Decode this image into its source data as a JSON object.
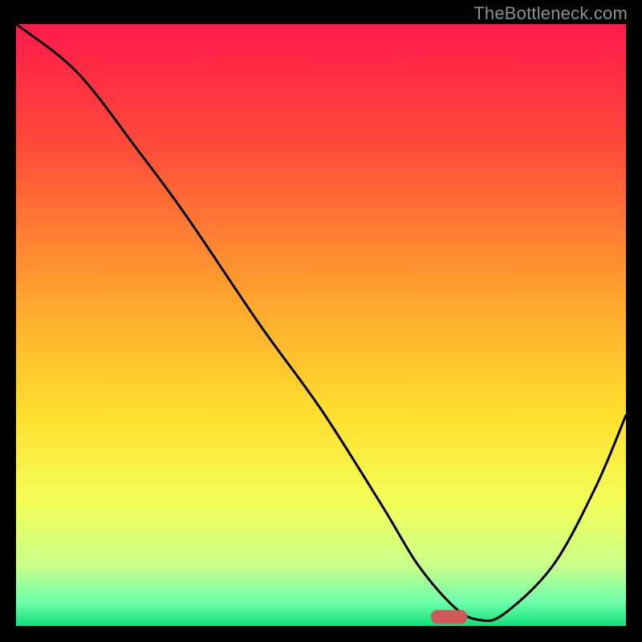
{
  "watermark": "TheBottleneck.com",
  "chart_data": {
    "type": "line",
    "title": "",
    "xlabel": "",
    "ylabel": "",
    "xlim": [
      0,
      100
    ],
    "ylim": [
      0,
      100
    ],
    "gradient_stops": [
      {
        "offset": 0,
        "color": "#ff1a4b"
      },
      {
        "offset": 20,
        "color": "#ff4a3a"
      },
      {
        "offset": 45,
        "color": "#ffa22e"
      },
      {
        "offset": 65,
        "color": "#ffe02e"
      },
      {
        "offset": 80,
        "color": "#f3ff5a"
      },
      {
        "offset": 90,
        "color": "#c9ff8a"
      },
      {
        "offset": 96,
        "color": "#6fffab"
      },
      {
        "offset": 100,
        "color": "#11e07a"
      }
    ],
    "series": [
      {
        "name": "bottleneck-curve",
        "x": [
          0,
          10,
          20,
          28,
          40,
          50,
          60,
          66,
          72,
          76,
          80,
          88,
          95,
          100
        ],
        "y": [
          100,
          92,
          79,
          68,
          50,
          36,
          20,
          10,
          3,
          1,
          2,
          10,
          23,
          35
        ]
      }
    ],
    "marker": {
      "name": "optimal-point",
      "x": 71,
      "y": 1.5,
      "color": "#d05a5a",
      "width": 6,
      "height": 2.3
    }
  }
}
